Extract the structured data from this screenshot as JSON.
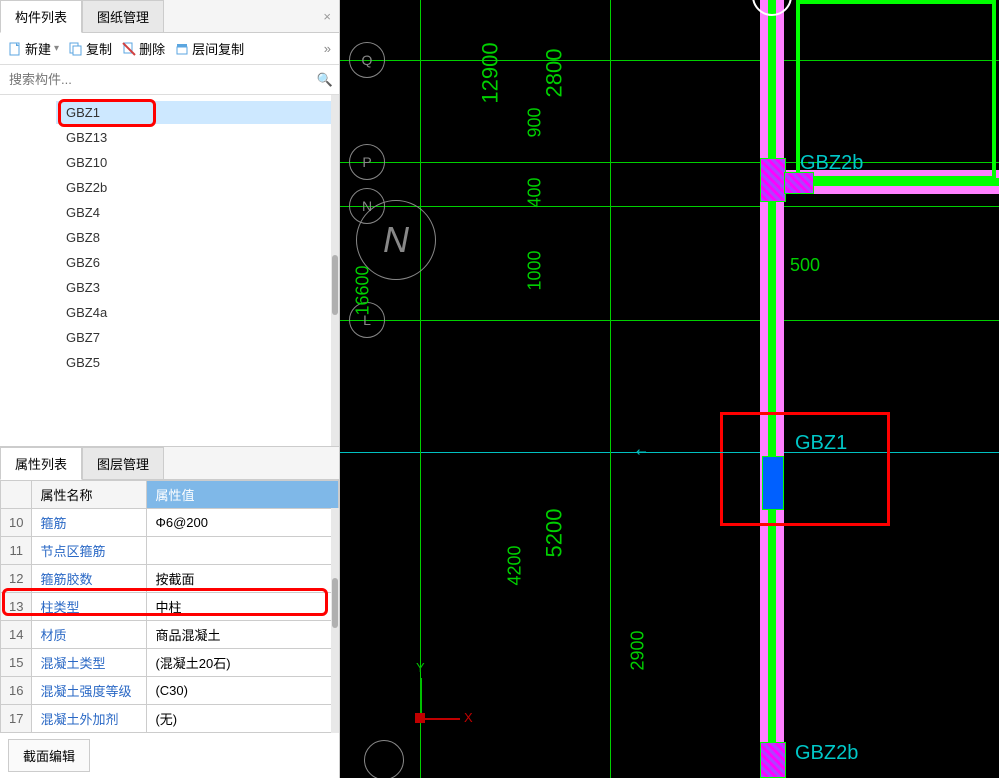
{
  "upper": {
    "tabs": [
      "构件列表",
      "图纸管理"
    ],
    "activeTab": 0,
    "toolbar": {
      "new": "新建",
      "copy": "复制",
      "delete": "删除",
      "layerCopy": "层间复制"
    },
    "search": {
      "placeholder": "搜索构件..."
    },
    "items": [
      "GBZ1",
      "GBZ13",
      "GBZ10",
      "GBZ2b",
      "GBZ4",
      "GBZ8",
      "GBZ6",
      "GBZ3",
      "GBZ4a",
      "GBZ7",
      "GBZ5"
    ],
    "selectedIndex": 0
  },
  "lower": {
    "tabs": [
      "属性列表",
      "图层管理"
    ],
    "activeTab": 0,
    "headers": {
      "name": "属性名称",
      "value": "属性值"
    },
    "rows": [
      {
        "num": "10",
        "name": "箍筋",
        "value": "Φ6@200"
      },
      {
        "num": "11",
        "name": "节点区箍筋",
        "value": ""
      },
      {
        "num": "12",
        "name": "箍筋胶数",
        "value": "按截面"
      },
      {
        "num": "13",
        "name": "柱类型",
        "value": "中柱"
      },
      {
        "num": "14",
        "name": "材质",
        "value": "商品混凝土"
      },
      {
        "num": "15",
        "name": "混凝土类型",
        "value": "(混凝土20石)"
      },
      {
        "num": "16",
        "name": "混凝土强度等级",
        "value": "(C30)"
      },
      {
        "num": "17",
        "name": "混凝土外加剂",
        "value": "(无)"
      }
    ],
    "footerBtn": "截面编辑"
  },
  "cad": {
    "axisLabels": {
      "Q": "Q",
      "P": "P",
      "N": "N",
      "L": "L",
      "bigN": "N"
    },
    "dims": {
      "d12900": "12900",
      "d2800": "2800",
      "d900": "900",
      "d400": "400",
      "d1000": "1000",
      "d16600": "16600",
      "d500": "500",
      "d5200": "5200",
      "d4200": "4200",
      "d2900": "2900"
    },
    "labels": {
      "GBZ2b_top": "GBZ2b",
      "GBZ1": "GBZ1",
      "GBZ2b_bot": "GBZ2b"
    },
    "gizmo": {
      "Y": "Y",
      "X": "X"
    }
  }
}
